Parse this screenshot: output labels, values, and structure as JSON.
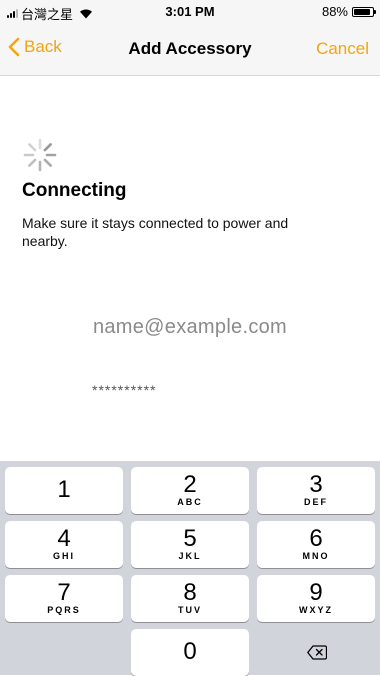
{
  "status_bar": {
    "carrier": "台灣之星",
    "time": "3:01 PM",
    "battery_text": "88%",
    "battery_level": 0.88
  },
  "nav": {
    "back_label": "Back",
    "title": "Add Accessory",
    "cancel_label": "Cancel"
  },
  "content": {
    "heading": "Connecting",
    "subtitle": "Make sure it stays connected to power and nearby.",
    "email": "name@example.com",
    "password_mask": "**********"
  },
  "keypad": {
    "keys": [
      {
        "digit": "1",
        "letters": ""
      },
      {
        "digit": "2",
        "letters": "ABC"
      },
      {
        "digit": "3",
        "letters": "DEF"
      },
      {
        "digit": "4",
        "letters": "GHI"
      },
      {
        "digit": "5",
        "letters": "JKL"
      },
      {
        "digit": "6",
        "letters": "MNO"
      },
      {
        "digit": "7",
        "letters": "PQRS"
      },
      {
        "digit": "8",
        "letters": "TUV"
      },
      {
        "digit": "9",
        "letters": "WXYZ"
      },
      {
        "digit": "0",
        "letters": ""
      }
    ],
    "delete_icon": "backspace-icon"
  },
  "colors": {
    "accent": "#f2a60c",
    "keypad_bg": "#d1d4da"
  }
}
